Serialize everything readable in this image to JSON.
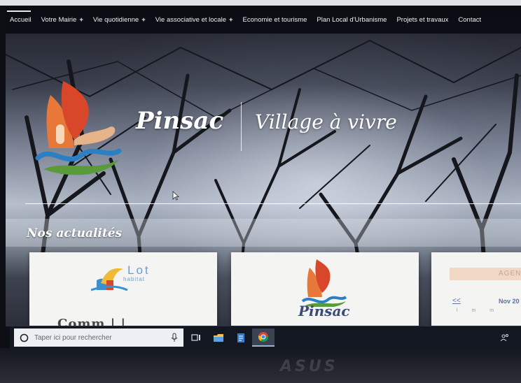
{
  "nav": {
    "items": [
      {
        "label": "Accueil",
        "dropdown": false
      },
      {
        "label": "Votre Mairie",
        "dropdown": true
      },
      {
        "label": "Vie quotidienne",
        "dropdown": true
      },
      {
        "label": "Vie associative et locale",
        "dropdown": true
      },
      {
        "label": "Economie et tourisme",
        "dropdown": false
      },
      {
        "label": "Plan Local d'Urbanisme",
        "dropdown": false
      },
      {
        "label": "Projets et travaux",
        "dropdown": false
      },
      {
        "label": "Contact",
        "dropdown": false
      }
    ],
    "plus_glyph": "+"
  },
  "hero": {
    "site_name": "Pinsac",
    "tagline": "Village à vivre"
  },
  "news": {
    "section_title": "Nos actualités",
    "card1": {
      "logo_title": "Lot",
      "logo_sub": "habitat",
      "heading": "Comm  |  |"
    },
    "card2": {
      "logo_name": "Pinsac"
    },
    "card3": {
      "header": "AGEN",
      "prev": "<<",
      "month": "Nov 20",
      "days": "l m m"
    }
  },
  "taskbar": {
    "search_placeholder": "Taper ici pour rechercher",
    "icons": [
      "search-icon",
      "mic-icon",
      "task-view-icon",
      "file-explorer-icon",
      "notepad-icon",
      "chrome-icon",
      "people-icon"
    ]
  },
  "device": {
    "brand": "ASUS"
  },
  "colors": {
    "nav_bg": "#0a0c12",
    "logo_orange": "#e8773a",
    "logo_red": "#d9472b",
    "logo_blue": "#2b7fc4",
    "logo_green": "#5b9a3a",
    "agenda_header": "#f1d8c6",
    "link_blue": "#5a6fa8"
  }
}
